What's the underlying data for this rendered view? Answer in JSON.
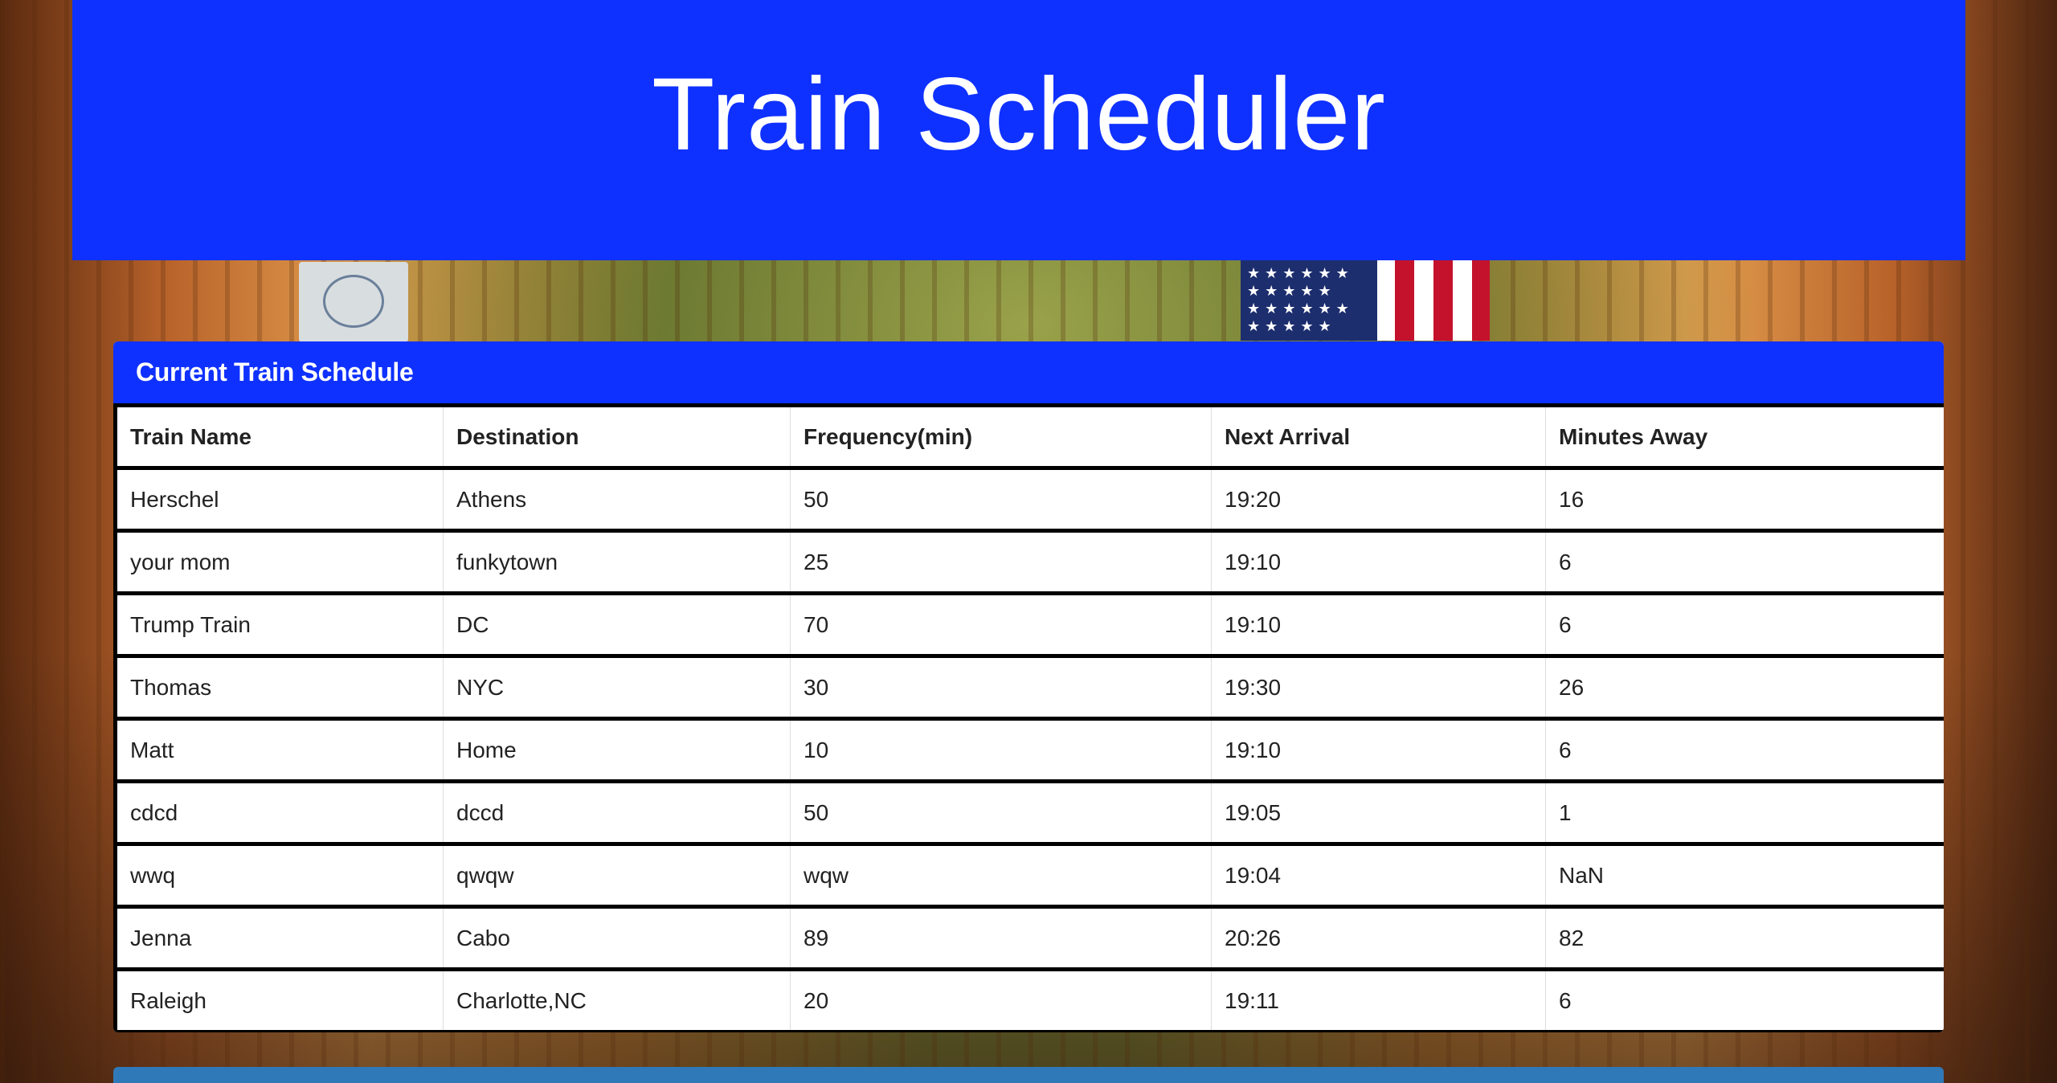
{
  "header": {
    "title": "Train Scheduler"
  },
  "schedule": {
    "panel_title": "Current Train Schedule",
    "columns": [
      "Train Name",
      "Destination",
      "Frequency(min)",
      "Next Arrival",
      "Minutes Away"
    ],
    "rows": [
      [
        "Herschel",
        "Athens",
        "50",
        "19:20",
        "16"
      ],
      [
        "your mom",
        "funkytown",
        "25",
        "19:10",
        "6"
      ],
      [
        "Trump Train",
        "DC",
        "70",
        "19:10",
        "6"
      ],
      [
        "Thomas",
        "NYC",
        "30",
        "19:30",
        "26"
      ],
      [
        "Matt",
        "Home",
        "10",
        "19:10",
        "6"
      ],
      [
        "cdcd",
        "dccd",
        "50",
        "19:05",
        "1"
      ],
      [
        "wwq",
        "qwqw",
        "wqw",
        "19:04",
        "NaN"
      ],
      [
        "Jenna",
        "Cabo",
        "89",
        "20:26",
        "82"
      ],
      [
        "Raleigh",
        "Charlotte,NC",
        "20",
        "19:11",
        "6"
      ]
    ]
  },
  "colors": {
    "header_bg": "#0f31ff",
    "panel_heading_bg": "#0f31ff",
    "bottom_panel_bg": "#3079b8"
  },
  "icons": {
    "background": "train-station-photo"
  }
}
